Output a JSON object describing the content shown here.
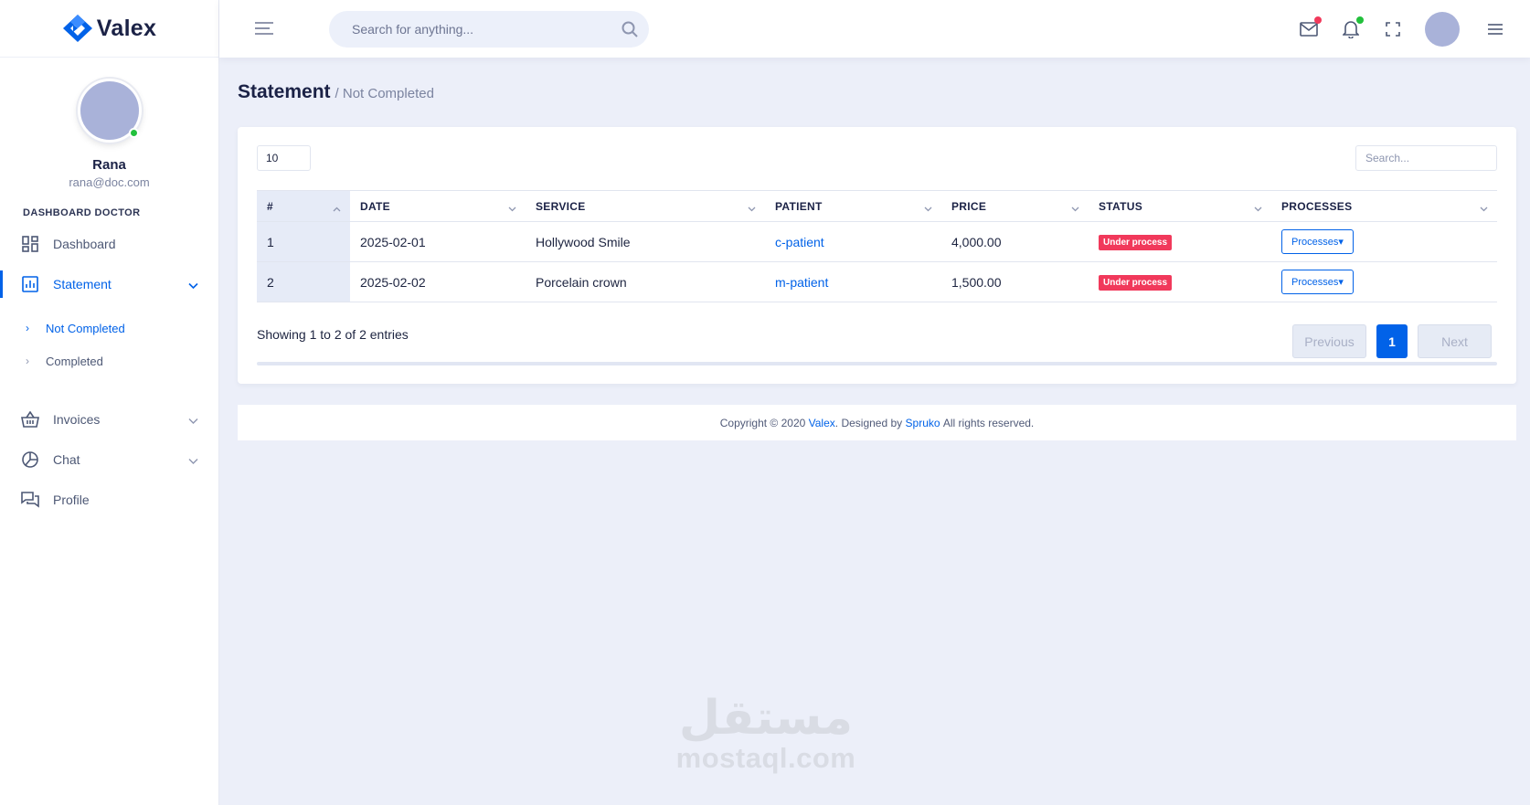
{
  "app": {
    "brand": "Valex"
  },
  "header": {
    "search_placeholder": "Search for anything...",
    "mail_badge_color": "#f1395b",
    "bell_badge_color": "#22c03c"
  },
  "user": {
    "name": "Rana",
    "email": "rana@doc.com"
  },
  "sidebar": {
    "category": "DASHBOARD DOCTOR",
    "items": [
      {
        "label": "Dashboard",
        "icon": "dashboard-icon"
      },
      {
        "label": "Statement",
        "icon": "chart-icon"
      },
      {
        "label": "Invoices",
        "icon": "basket-icon"
      },
      {
        "label": "Chat",
        "icon": "pie-icon"
      },
      {
        "label": "Profile",
        "icon": "chat-bubbles-icon"
      }
    ],
    "statement_sub": [
      {
        "label": "Not Completed"
      },
      {
        "label": "Completed"
      }
    ]
  },
  "page": {
    "title": "Statement",
    "breadcrumb": "/ Not Completed"
  },
  "table_controls": {
    "length": "10",
    "search_placeholder": "Search..."
  },
  "table": {
    "columns": [
      "#",
      "DATE",
      "SERVICE",
      "PATIENT",
      "PRICE",
      "STATUS",
      "PROCESSES"
    ],
    "rows": [
      {
        "num": "1",
        "date": "2025-02-01",
        "service": "Hollywood Smile",
        "patient": "c-patient",
        "price": "4,000.00",
        "status": "Under process",
        "action": "Processes▾"
      },
      {
        "num": "2",
        "date": "2025-02-02",
        "service": "Porcelain crown",
        "patient": "m-patient",
        "price": "1,500.00",
        "status": "Under process",
        "action": "Processes▾"
      }
    ]
  },
  "pagination": {
    "info": "Showing 1 to 2 of 2 entries",
    "previous": "Previous",
    "current": "1",
    "next": "Next"
  },
  "footer": {
    "prefix": "Copyright © 2020",
    "brand": "Valex",
    "middle": ". Designed by",
    "designer": "Spruko",
    "suffix": "All rights reserved."
  },
  "watermark": {
    "arabic": "مستقل",
    "domain": "mostaql.com"
  },
  "colors": {
    "primary": "#0162e8",
    "danger": "#f1395b",
    "success": "#22c03c"
  }
}
